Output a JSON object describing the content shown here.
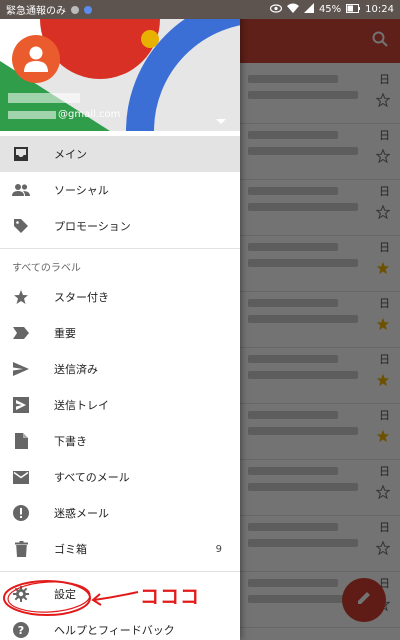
{
  "status": {
    "emergency_label": "緊急通報のみ",
    "battery": "45%",
    "time": "10:24"
  },
  "account": {
    "email_suffix": "@gmail.com",
    "avatar_color": "#ea5c2d"
  },
  "drawer": {
    "primary": [
      {
        "label": "メイン",
        "icon": "inbox-icon"
      },
      {
        "label": "ソーシャル",
        "icon": "people-icon"
      },
      {
        "label": "プロモーション",
        "icon": "tag-icon"
      }
    ],
    "section_label": "すべてのラベル",
    "labels": [
      {
        "label": "スター付き",
        "icon": "star-icon"
      },
      {
        "label": "重要",
        "icon": "important-icon"
      },
      {
        "label": "送信済み",
        "icon": "send-icon"
      },
      {
        "label": "送信トレイ",
        "icon": "outbox-icon"
      },
      {
        "label": "下書き",
        "icon": "draft-icon"
      },
      {
        "label": "すべてのメール",
        "icon": "all-mail-icon"
      },
      {
        "label": "迷惑メール",
        "icon": "spam-icon"
      },
      {
        "label": "ゴミ箱",
        "icon": "trash-icon",
        "count": "9"
      }
    ],
    "settings_label": "設定",
    "help_label": "ヘルプとフィードバック"
  },
  "inbox_rows": [
    {
      "date": "日",
      "starred": false
    },
    {
      "date": "日",
      "starred": false
    },
    {
      "date": "日",
      "starred": false
    },
    {
      "date": "日",
      "starred": true
    },
    {
      "date": "日",
      "starred": true
    },
    {
      "date": "日",
      "starred": true
    },
    {
      "date": "日",
      "starred": true
    },
    {
      "date": "日",
      "starred": false
    },
    {
      "date": "日",
      "starred": false
    },
    {
      "date": "日",
      "starred": false
    }
  ],
  "annotation": {
    "text": "コココ",
    "color": "#e21a1a"
  },
  "colors": {
    "accent": "#d14836",
    "fab": "#d23f31",
    "star": "#f4b400"
  }
}
